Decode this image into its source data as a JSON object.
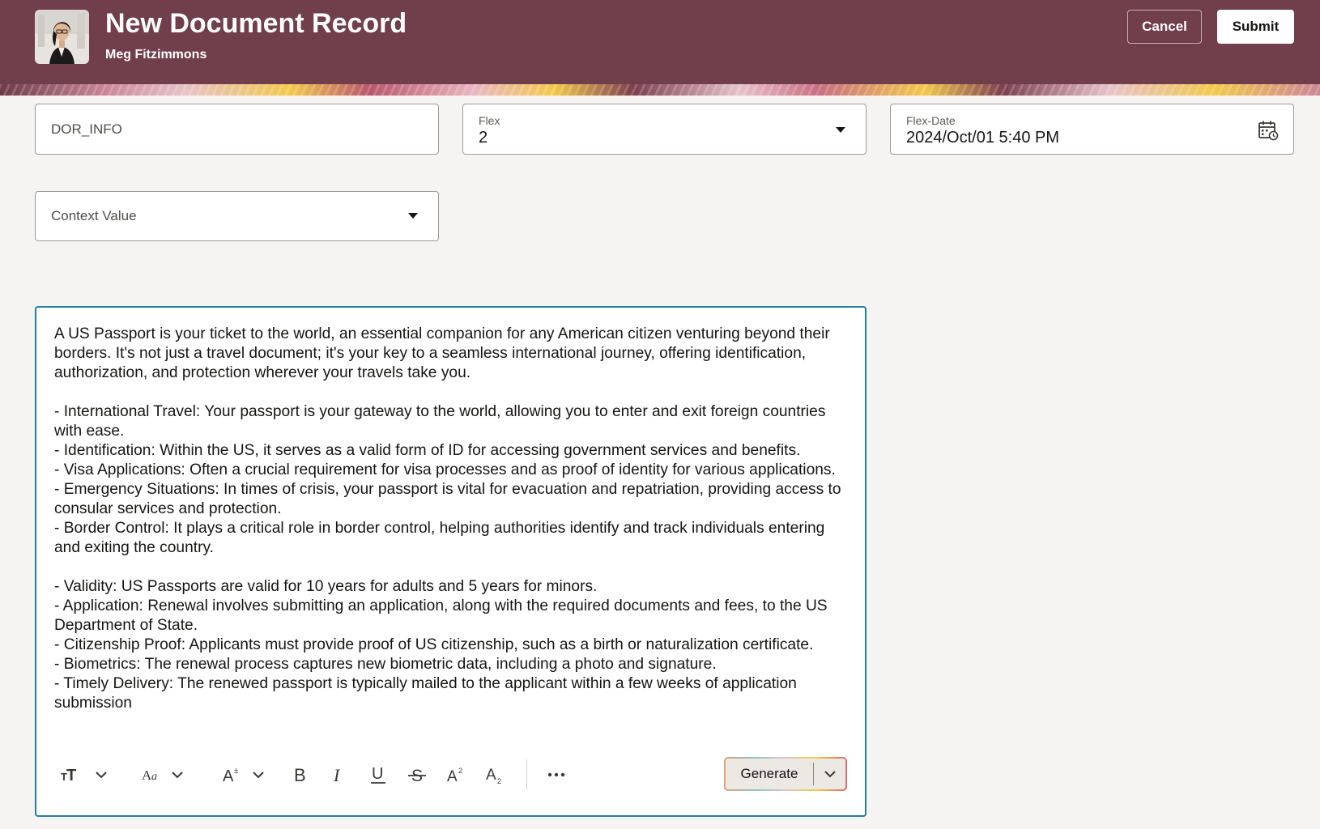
{
  "header": {
    "title": "New Document Record",
    "subtitle": "Meg Fitzimmons",
    "cancel_label": "Cancel",
    "submit_label": "Submit",
    "background_color": "#713e4b"
  },
  "form": {
    "dor_info": {
      "value": "DOR_INFO"
    },
    "flex": {
      "label": "Flex",
      "value": "2"
    },
    "flex_date": {
      "label": "Flex-Date",
      "value": "2024/Oct/01 5:40 PM"
    },
    "context_value": {
      "placeholder": "Context Value"
    }
  },
  "editor": {
    "content": "A US Passport is your ticket to the world, an essential companion for any American citizen venturing beyond their borders. It's not just a travel document; it's your key to a seamless international journey, offering identification, authorization, and protection wherever your travels take you.\n\n- International Travel: Your passport is your gateway to the world, allowing you to enter and exit foreign countries with ease.\n- Identification: Within the US, it serves as a valid form of ID for accessing government services and benefits.\n- Visa Applications: Often a crucial requirement for visa processes and as proof of identity for various applications.\n- Emergency Situations: In times of crisis, your passport is vital for evacuation and repatriation, providing access to consular services and protection.\n- Border Control: It plays a critical role in border control, helping authorities identify and track individuals entering and exiting the country.\n\n- Validity: US Passports are valid for 10 years for adults and 5 years for minors.\n- Application: Renewal involves submitting an application, along with the required documents and fees, to the US Department of State.\n- Citizenship Proof: Applicants must provide proof of US citizenship, such as a birth or naturalization certificate.\n- Biometrics: The renewal process captures new biometric data, including a photo and signature.\n- Timely Delivery: The renewed passport is typically mailed to the applicant within a few weeks of application submission",
    "border_color": "#227e9e",
    "toolbar": {
      "icons": [
        "text-size-icon",
        "font-family-icon",
        "font-size-icon",
        "bold-icon",
        "italic-icon",
        "underline-icon",
        "strikethrough-icon",
        "superscript-icon",
        "subscript-icon",
        "more-icon"
      ],
      "generate_label": "Generate"
    }
  }
}
